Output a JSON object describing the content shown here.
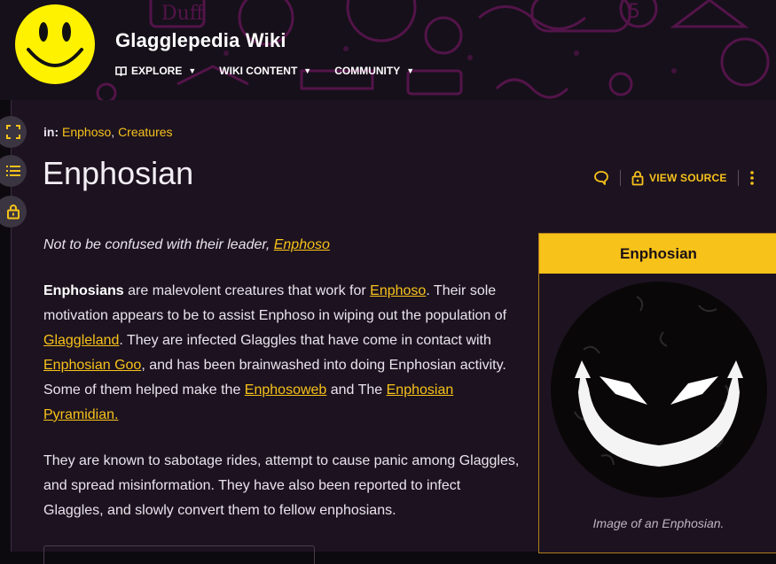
{
  "site": {
    "title": "Glagglepedia Wiki",
    "nav": [
      {
        "label": "EXPLORE",
        "icon": "book-icon"
      },
      {
        "label": "WIKI CONTENT"
      },
      {
        "label": "COMMUNITY"
      }
    ]
  },
  "rail": {
    "icons": [
      "expand-icon",
      "table-of-contents-icon",
      "lock-icon"
    ]
  },
  "article": {
    "categories_label": "in:",
    "categories": [
      "Enphoso",
      "Creatures"
    ],
    "categories_sep": ", ",
    "title": "Enphosian",
    "actions": {
      "talk_icon": "speech-bubble-icon",
      "view_source_label": "VIEW SOURCE",
      "more_icon": "kebab-menu-icon"
    },
    "hatnote_prefix": "Not to be confused with their leader, ",
    "hatnote_link": "Enphoso",
    "p1": {
      "bold": "Enphosians",
      "t1": " are malevolent creatures that work for ",
      "l1": "Enphoso",
      "t2": ". Their sole motivation appears to be to assist Enphoso in wiping out the population of ",
      "l2": "Glaggleland",
      "t3": ". They are infected Glaggles that have come in contact with ",
      "l3": "Enphosian Goo",
      "t4": ", and has been brainwashed into doing Enphosian activity. Some of them helped make the ",
      "l4": "Enphosoweb",
      "t5": " and The ",
      "l5": "Enphosian Pyramidian."
    },
    "p2": "They are known to sabotage rides, attempt to cause panic among Glaggles, and spread misinformation. They have also been reported to infect Glaggles, and slowly convert them to fellow enphosians."
  },
  "infobox": {
    "title": "Enphosian",
    "caption": "Image of an Enphosian."
  },
  "colors": {
    "accent": "#f7c21a",
    "page_bg": "#1d1320",
    "header_bg": "#16101a",
    "header_pattern": "#6b1a5e"
  }
}
